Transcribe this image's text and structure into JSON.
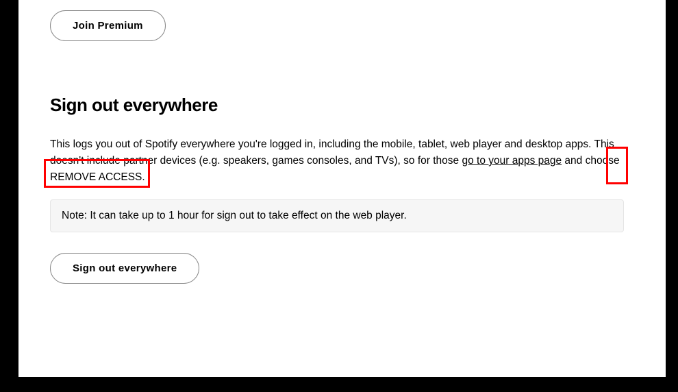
{
  "buttons": {
    "join_premium": "Join Premium",
    "sign_out": "Sign out everywhere"
  },
  "section": {
    "heading": "Sign out everywhere",
    "description_part1": "This logs you out of Spotify everywhere you're logged in, including the mobile, tablet, web player and desktop apps. This doesn't include partner devices (e.g. speakers, games consoles, and TVs), so for those ",
    "link_text": "go to your apps page",
    "description_part2": " and choose REMOVE ACCESS.",
    "note": "Note: It can take up to 1 hour for sign out to take effect on the web player."
  }
}
